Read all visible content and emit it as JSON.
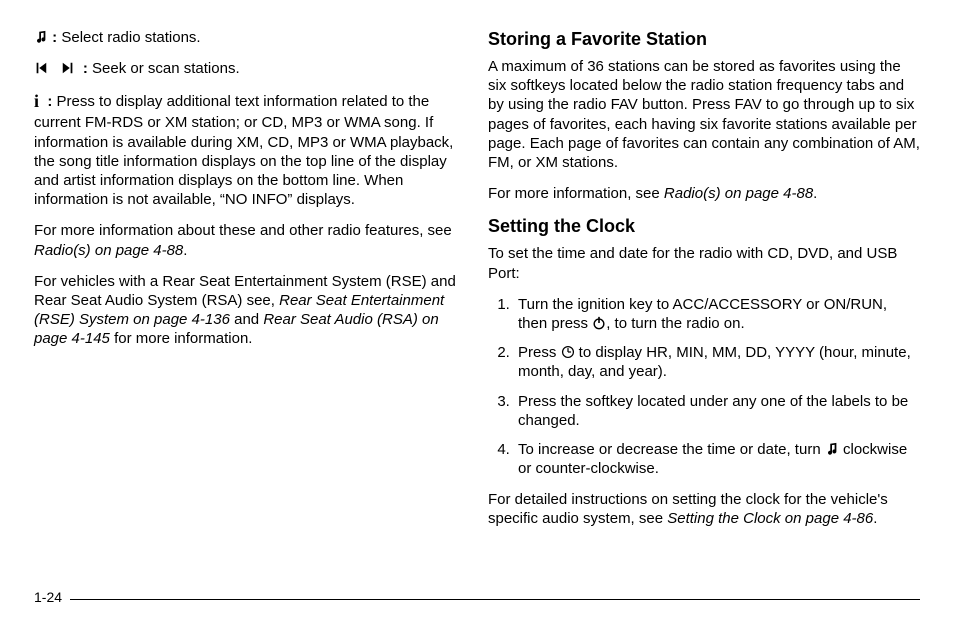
{
  "left": {
    "item1": {
      "label": "Select radio stations."
    },
    "item2": {
      "label": "Seek or scan stations."
    },
    "item3": {
      "label": "Press to display additional text information related to the current FM-RDS or XM station; or CD, MP3 or WMA song. If information is available during XM, CD, MP3 or WMA playback, the song title information displays on the top line of the display and artist information displays on the bottom line. When information is not available, “NO INFO” displays."
    },
    "p4a": "For more information about these and other radio features, see ",
    "p4b": "Radio(s) on page 4-88",
    "p4c": ".",
    "p5a": "For vehicles with a Rear Seat Entertainment System (RSE) and Rear Seat Audio System (RSA) see, ",
    "p5b": "Rear Seat Entertainment (RSE) System on page 4-136",
    "p5c": " and ",
    "p5d": "Rear Seat Audio (RSA) on page 4-145",
    "p5e": " for more information."
  },
  "right": {
    "h1": "Storing a Favorite Station",
    "p1": "A maximum of 36 stations can be stored as favorites using the six softkeys located below the radio station frequency tabs and by using the radio FAV button. Press FAV to go through up to six pages of favorites, each having six favorite stations available per page. Each page of favorites can contain any combination of AM, FM, or XM stations.",
    "p2a": "For more information, see ",
    "p2b": "Radio(s) on page 4-88",
    "p2c": ".",
    "h2": "Setting the Clock",
    "p3": "To set the time and date for the radio with CD, DVD, and USB Port:",
    "li1a": "Turn the ignition key to ACC/ACCESSORY or ON/RUN, then press ",
    "li1b": ", to turn the radio on.",
    "li2a": "Press ",
    "li2b": " to display HR, MIN, MM, DD, YYYY (hour, minute, month, day, and year).",
    "li3": "Press the softkey located under any one of the labels to be changed.",
    "li4a": "To increase or decrease the time or date, turn ",
    "li4b": " clockwise or counter-clockwise.",
    "p4a": "For detailed instructions on setting the clock for the vehicle's specific audio system, see ",
    "p4b": "Setting the Clock on page 4-86",
    "p4c": "."
  },
  "footer": {
    "page": "1-24"
  }
}
